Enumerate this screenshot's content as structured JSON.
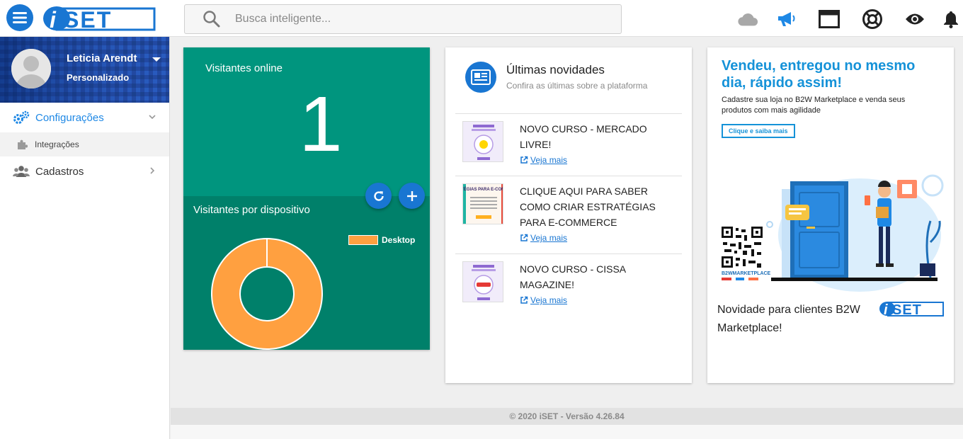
{
  "header": {
    "logo_text": "iSET",
    "search": {
      "placeholder": "Busca inteligente...",
      "value": ""
    },
    "icons": [
      "menu-icon",
      "cloud-icon",
      "megaphone-icon",
      "window-icon",
      "lifebuoy-icon",
      "eye-icon",
      "bell-icon"
    ],
    "accent": "#1976d2"
  },
  "sidebar": {
    "user": {
      "name": "Leticia Arendt",
      "role": "Personalizado"
    },
    "menu": [
      {
        "label": "Configurações",
        "icon": "gears-icon",
        "active": true,
        "expanded": true,
        "children": [
          {
            "label": "Integrações",
            "icon": "puzzle-icon"
          }
        ]
      },
      {
        "label": "Cadastros",
        "icon": "users-icon",
        "active": false,
        "expanded": false
      }
    ]
  },
  "visitors": {
    "title": "Visitantes online",
    "count": "1",
    "by_device_title": "Visitantes por dispositivo",
    "color_top": "#00957e",
    "color_bottom": "#00806a",
    "chart_data": {
      "type": "pie",
      "labels": [
        "Desktop"
      ],
      "values": [
        1
      ],
      "colors": [
        "#ffa040"
      ],
      "legend": "top-right"
    }
  },
  "news": {
    "title": "Últimas novidades",
    "subtitle": "Confira as últimas sobre a plataforma",
    "link_label": "Veja mais",
    "items": [
      {
        "title": "NOVO CURSO - MERCADO LIVRE!"
      },
      {
        "title": "CLIQUE AQUI PARA SABER COMO CRIAR ESTRATÉGIAS PARA E-COMMERCE",
        "thumb_heading": "ESTRATÉGIAS PARA E-COMMERCE"
      },
      {
        "title": "NOVO CURSO - CISSA MAGAZINE!"
      }
    ]
  },
  "ad": {
    "headline": "Vendeu, entregou no mesmo dia, rápido assim!",
    "text": "Cadastre sua loja no B2W Marketplace e venda seus produtos com mais agilidade",
    "button": "Clique e saiba mais",
    "qr_caption": "B2WMARKETPLACE",
    "caption": "Novidade para clientes B2W Marketplace!",
    "accent": "#1592d8"
  },
  "footer": {
    "text": "© 2020 iSET - Versão 4.26.84"
  }
}
